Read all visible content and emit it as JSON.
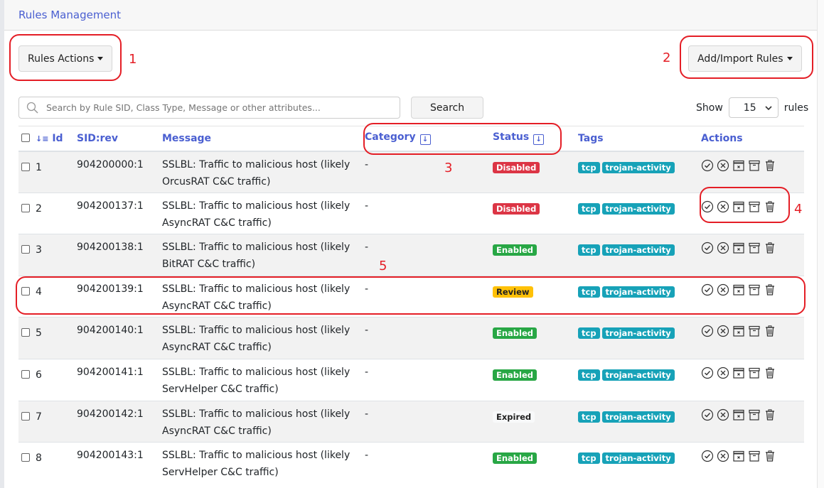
{
  "header": {
    "title": "Rules Management"
  },
  "toolbar": {
    "rules_actions": "Rules Actions",
    "add_import": "Add/Import Rules"
  },
  "search": {
    "placeholder": "Search by Rule SID, Class Type, Message or other attributes...",
    "button": "Search"
  },
  "pagination": {
    "show_label": "Show",
    "page_size": "15",
    "rules_label": "rules"
  },
  "table": {
    "columns": [
      "Id",
      "SID:rev",
      "Message",
      "Category",
      "Status",
      "Tags",
      "Actions"
    ],
    "rows": [
      {
        "id": "1",
        "sid": "904200000:1",
        "message": "SSLBL: Traffic to malicious host (likely OrcusRAT C&C traffic)",
        "category": "-",
        "status": "Disabled",
        "tags": [
          "tcp",
          "trojan-activity"
        ]
      },
      {
        "id": "2",
        "sid": "904200137:1",
        "message": "SSLBL: Traffic to malicious host (likely AsyncRAT C&C traffic)",
        "category": "-",
        "status": "Disabled",
        "tags": [
          "tcp",
          "trojan-activity"
        ]
      },
      {
        "id": "3",
        "sid": "904200138:1",
        "message": "SSLBL: Traffic to malicious host (likely BitRAT C&C traffic)",
        "category": "-",
        "status": "Enabled",
        "tags": [
          "tcp",
          "trojan-activity"
        ]
      },
      {
        "id": "4",
        "sid": "904200139:1",
        "message": "SSLBL: Traffic to malicious host (likely AsyncRAT C&C traffic)",
        "category": "-",
        "status": "Review",
        "tags": [
          "tcp",
          "trojan-activity"
        ]
      },
      {
        "id": "5",
        "sid": "904200140:1",
        "message": "SSLBL: Traffic to malicious host (likely AsyncRAT C&C traffic)",
        "category": "-",
        "status": "Enabled",
        "tags": [
          "tcp",
          "trojan-activity"
        ]
      },
      {
        "id": "6",
        "sid": "904200141:1",
        "message": "SSLBL: Traffic to malicious host (likely ServHelper C&C traffic)",
        "category": "-",
        "status": "Enabled",
        "tags": [
          "tcp",
          "trojan-activity"
        ]
      },
      {
        "id": "7",
        "sid": "904200142:1",
        "message": "SSLBL: Traffic to malicious host (likely AsyncRAT C&C traffic)",
        "category": "-",
        "status": "Expired",
        "tags": [
          "tcp",
          "trojan-activity"
        ]
      },
      {
        "id": "8",
        "sid": "904200143:1",
        "message": "SSLBL: Traffic to malicious host (likely ServHelper C&C traffic)",
        "category": "-",
        "status": "Enabled",
        "tags": [
          "tcp",
          "trojan-activity"
        ]
      }
    ]
  },
  "status_colors": {
    "Disabled": "#dc3545",
    "Enabled": "#28a745",
    "Review": "#ffc107",
    "Expired": "#f8f9fa"
  },
  "action_icons": [
    "check-circle-icon",
    "x-circle-icon",
    "calendar-x-icon",
    "archive-icon",
    "trash-icon"
  ],
  "annotations": [
    "1",
    "2",
    "3",
    "4",
    "5"
  ]
}
